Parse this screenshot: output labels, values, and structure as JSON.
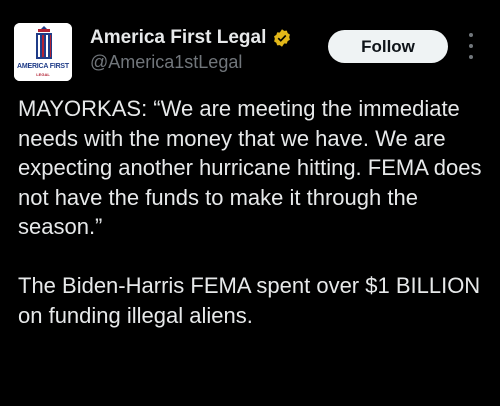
{
  "author": {
    "display_name": "America First Legal",
    "handle": "@America1stLegal",
    "avatar_text": "AMERICA FIRST",
    "avatar_subtext": "LEGAL",
    "verified_color": "#e2b719"
  },
  "actions": {
    "follow_label": "Follow",
    "more_icon": "more-vertical-icon"
  },
  "post": {
    "paragraph1": "MAYORKAS: “We are meeting the immediate needs with the money that we have. We are expecting another hurricane hitting. FEMA does not have the funds to make it through the season.”",
    "paragraph2": "The Biden-Harris FEMA spent over $1 BILLION on funding illegal aliens."
  },
  "colors": {
    "background": "#000000",
    "text": "#e7e9ea",
    "secondary_text": "#71767b",
    "button_bg": "#eff3f4"
  }
}
